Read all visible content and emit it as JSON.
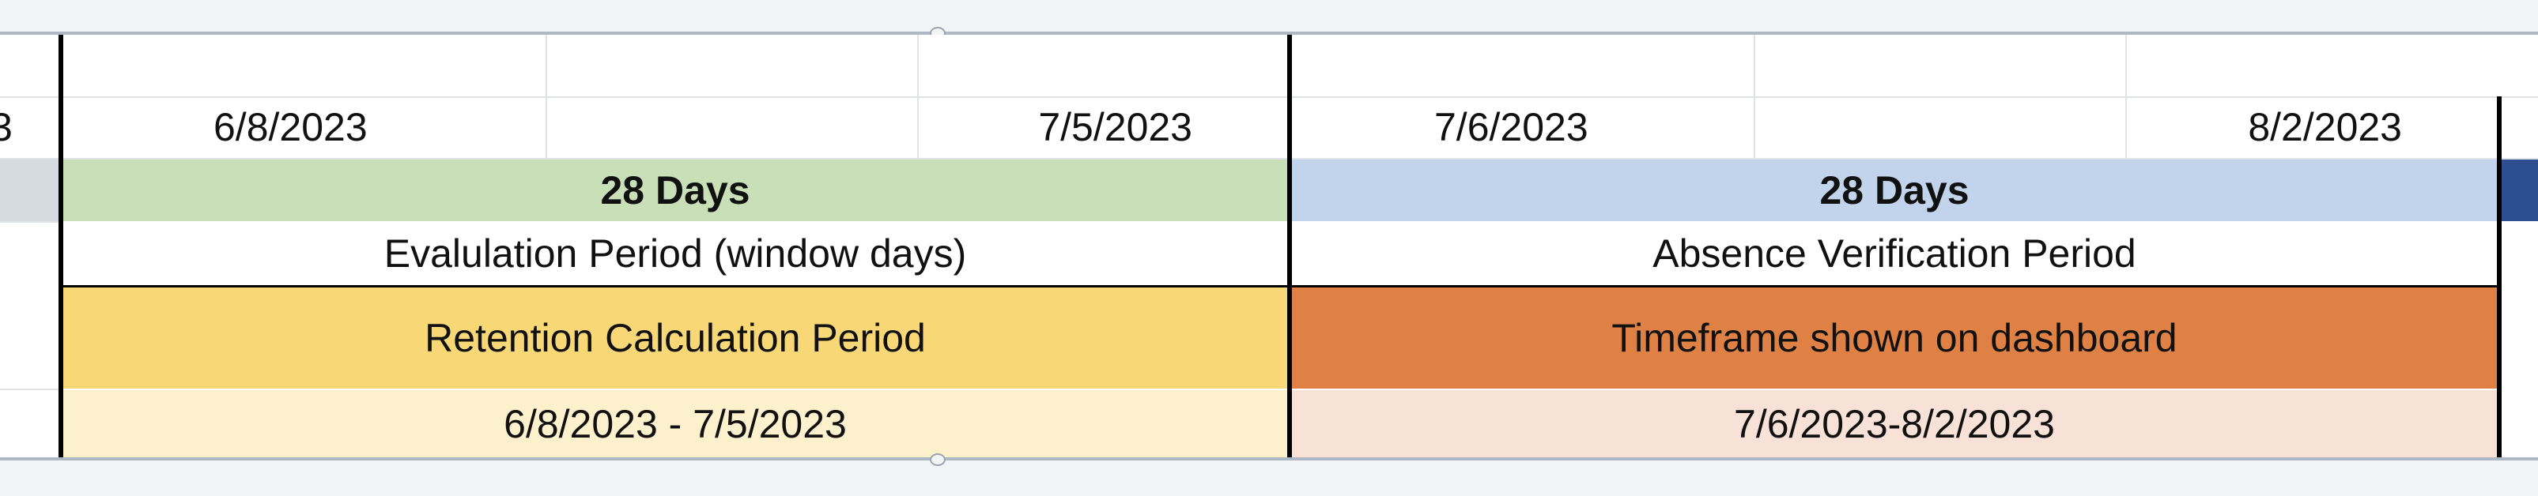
{
  "sheet": {
    "left_partial_text": "3",
    "dates": {
      "eval_start": "6/8/2023",
      "eval_end": "7/5/2023",
      "abs_start": "7/6/2023",
      "abs_end": "8/2/2023"
    },
    "eval": {
      "days_label": "28 Days",
      "period_label": "Evalulation Period (window days)",
      "calc_label": "Retention Calculation Period",
      "range_label": "6/8/2023 - 7/5/2023"
    },
    "absence": {
      "days_label": "28 Days",
      "period_label": "Absence Verification Period",
      "dashboard_label": "Timeframe shown on dashboard",
      "range_label": "7/6/2023-8/2/2023"
    },
    "colors": {
      "green_header": "#c9dfb8",
      "blue_header": "#c2d4ec",
      "yellow_fill": "#f8d776",
      "orange_fill": "#df8044",
      "light_yellow_fill": "#fdf1cd",
      "light_pink_fill": "#f8e1d7",
      "navy_fill": "#2e4e92"
    }
  }
}
